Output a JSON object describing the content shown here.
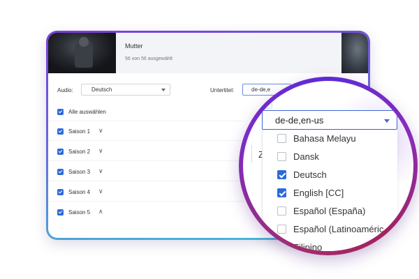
{
  "episode": {
    "title": "Mutter",
    "subtitle": "56 von 56 ausgewählt"
  },
  "audio": {
    "label": "Audio:",
    "value": "Deutsch"
  },
  "subtitles": {
    "label": "Untertitel:",
    "value": "de-de,e"
  },
  "select_all_label": "Alle auswählen",
  "seasons": [
    {
      "label": "Saison 1",
      "chevron": "∨"
    },
    {
      "label": "Saison 2",
      "chevron": "∨"
    },
    {
      "label": "Saison 3",
      "chevron": "∨"
    },
    {
      "label": "Saison 4",
      "chevron": "∨"
    },
    {
      "label": "Saison 5",
      "chevron": "∧"
    }
  ],
  "magnifier": {
    "partial_label": "l:",
    "partial_text": "Z",
    "select_value": "de-de,en-us",
    "options": [
      {
        "label": "Bahasa Melayu",
        "checked": false
      },
      {
        "label": "Dansk",
        "checked": false
      },
      {
        "label": "Deutsch",
        "checked": true
      },
      {
        "label": "English [CC]",
        "checked": true
      },
      {
        "label": "Español (España)",
        "checked": false
      },
      {
        "label": "Español (Latinoaméric",
        "checked": false
      },
      {
        "label": "Filipino",
        "checked": false
      }
    ]
  },
  "colors": {
    "accent": "#2d6ad8",
    "frame_start": "#7a3fd6",
    "frame_end": "#3fc3d6",
    "lens_ring": "#8a2cb8"
  }
}
